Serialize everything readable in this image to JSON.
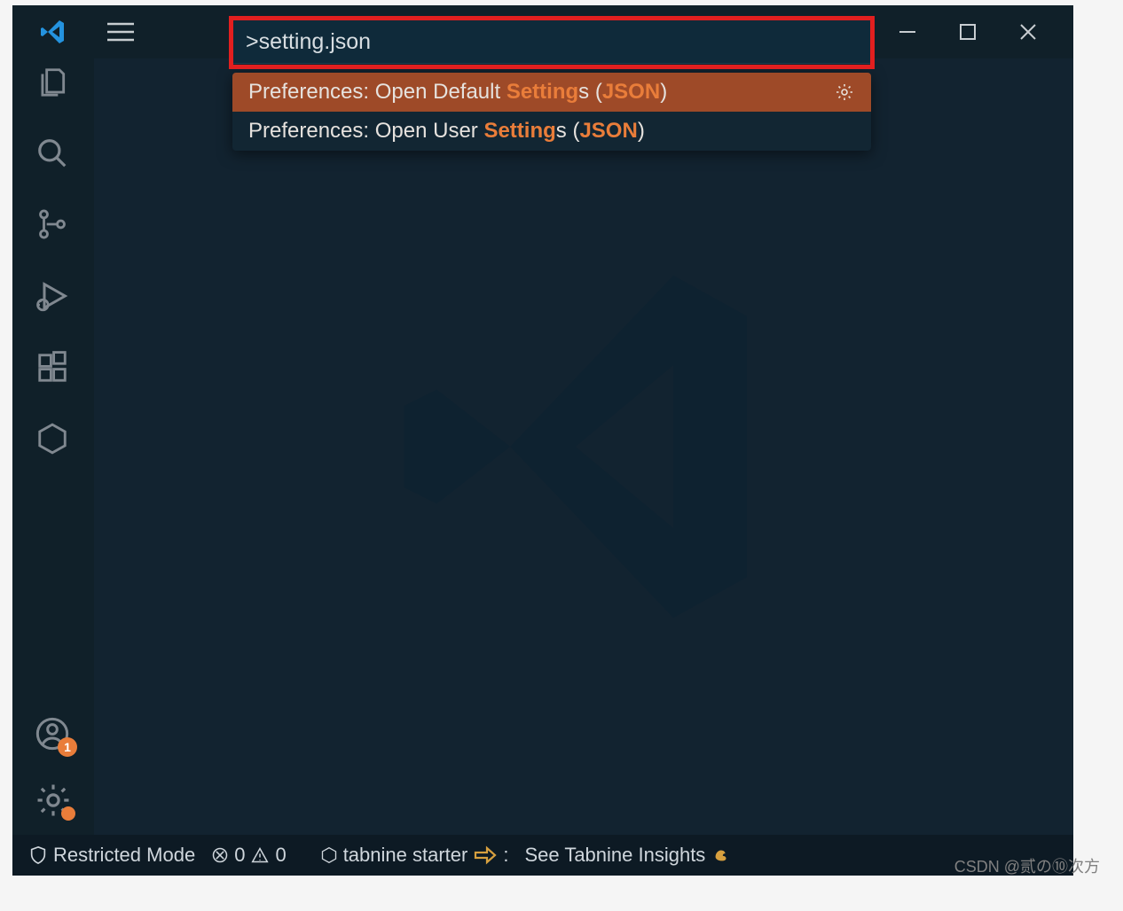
{
  "command_palette": {
    "input_value": ">setting.json",
    "results": [
      {
        "prefix": "Preferences: Open Default ",
        "hl1": "Setting",
        "mid": "s (",
        "hl2": "JSON",
        "suffix": ")",
        "selected": true
      },
      {
        "prefix": "Preferences: Open User ",
        "hl1": "Setting",
        "mid": "s (",
        "hl2": "JSON",
        "suffix": ")",
        "selected": false
      }
    ]
  },
  "account_badge": "1",
  "statusbar": {
    "restricted": "Restricted Mode",
    "errors": "0",
    "warnings": "0",
    "tabnine": "tabnine starter",
    "colon": ":",
    "insights": "See Tabnine Insights"
  },
  "watermark": "CSDN @贰の⑩次方"
}
